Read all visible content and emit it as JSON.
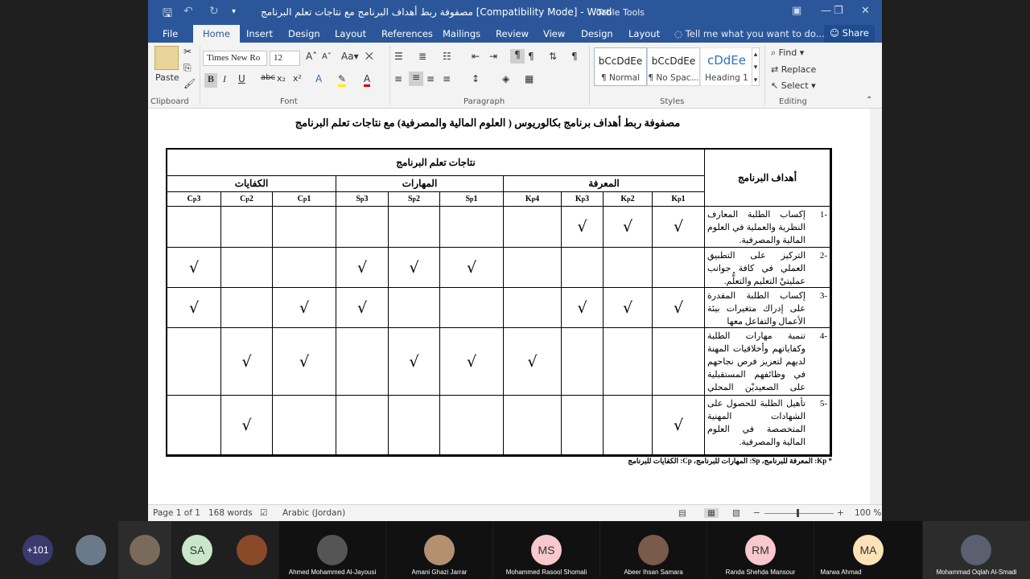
{
  "window": {
    "title": "مصفوفة ربط أهداف البرنامج مع نتاجات تعلم البرنامج [Compatibility Mode] - Word",
    "table_tools": "Table Tools"
  },
  "tabs": {
    "file": "File",
    "home": "Home",
    "insert": "Insert",
    "design": "Design",
    "layout": "Layout",
    "references": "References",
    "mailings": "Mailings",
    "review": "Review",
    "view": "View",
    "design2": "Design",
    "layout2": "Layout",
    "tell": "Tell me what you want to do...",
    "share": "Share"
  },
  "ribbon": {
    "paste": "Paste",
    "clipboard": "Clipboard",
    "font_name": "Times New Ro",
    "font_size": "12",
    "font": "Font",
    "paragraph": "Paragraph",
    "styles": "Styles",
    "editing": "Editing",
    "style_items": [
      {
        "preview": "bCcDdEe",
        "name": "¶ Normal"
      },
      {
        "preview": "bCcDdEe",
        "name": "¶ No Spac..."
      },
      {
        "preview": "cDdEe",
        "name": "Heading 1"
      }
    ],
    "find": "Find",
    "replace": "Replace",
    "select": "Select"
  },
  "document": {
    "heading": "مصفوفة ربط أهداف برنامج بكالوريوس ( العلوم المالية والمصرفية) مع نتاجات تعلم البرنامج",
    "table": {
      "outcomes_header": "نتاجات تعلم البرنامج",
      "objectives_header": "أهداف البرنامج",
      "groups": [
        "المعرفة",
        "المهارات",
        "الكفايات"
      ],
      "codes": [
        "Kp1",
        "Kp2",
        "Kp3",
        "Kp4",
        "Sp1",
        "Sp2",
        "Sp3",
        "Cp1",
        "Cp2",
        "Cp3"
      ],
      "check": "√",
      "rows": [
        {
          "num": "-1",
          "text": "إكساب الطلبة المعارف النظرية والعملية في العلوم المالية والمصرفية.",
          "checks": [
            1,
            1,
            1,
            0,
            0,
            0,
            0,
            0,
            0,
            0
          ]
        },
        {
          "num": "-2",
          "text": "التركيز على التطبيق العملي في كافة جوانب عمليتيْ التعليم والتعلُّم.",
          "checks": [
            0,
            0,
            0,
            0,
            1,
            1,
            1,
            0,
            0,
            1
          ]
        },
        {
          "num": "-3",
          "text": "إكساب الطلبة المقدرة على إدراك متغيرات بيئة الأعمال والتفاعل معها",
          "checks": [
            1,
            1,
            1,
            0,
            0,
            0,
            1,
            1,
            0,
            1
          ]
        },
        {
          "num": "-4",
          "text": "تنمية مهارات الطلبة وكفاياتهم وأخلاقيات المهنة لديهم لتعزيز فرص نجاحهم في وظائفهم المستقبلية على الصعيديْن المحلي والدولي.",
          "checks": [
            0,
            0,
            0,
            1,
            1,
            1,
            0,
            1,
            1,
            0
          ]
        },
        {
          "num": "-5",
          "text": "تأهيل الطلبة للحصول على الشهادات المهنية المتخصصة في العلوم المالية والمصرفية.",
          "checks": [
            1,
            0,
            0,
            0,
            0,
            0,
            0,
            0,
            1,
            0
          ]
        }
      ]
    },
    "footnote": "* Kp: المعرفة للبرنامج، Sp: المهارات للبرنامج، Cp: الكفايات للبرنامج"
  },
  "status": {
    "page": "Page 1 of 1",
    "words": "168 words",
    "language": "Arabic (Jordan)",
    "zoom": "100 %"
  },
  "meeting": {
    "more_count": "+101",
    "participants": [
      {
        "initials": "SA",
        "name": "",
        "color": "#c8e6c9"
      },
      {
        "initials": "",
        "name": "Ahmed Mohammed Al-Jayousi",
        "color": ""
      },
      {
        "initials": "",
        "name": "Amani Ghazi Jarrar",
        "color": ""
      },
      {
        "initials": "MS",
        "name": "Mohammed Rasool Shomali",
        "color": "#f8c8cc"
      },
      {
        "initials": "",
        "name": "Abeer Ihsan Samara",
        "color": ""
      },
      {
        "initials": "RM",
        "name": "Randa Shehda Mansour",
        "color": "#f8c8cc"
      },
      {
        "initials": "MA",
        "name": "Marwa Ahmad",
        "color": "#fde2b8"
      },
      {
        "initials": "",
        "name": "Mohammad Oqlah Al-Smadi",
        "color": ""
      }
    ]
  }
}
